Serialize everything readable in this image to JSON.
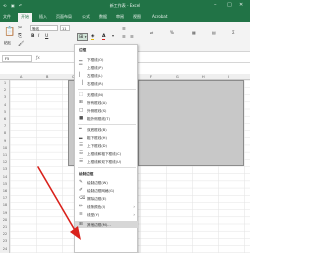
{
  "window": {
    "title": "新工作表 - Excel",
    "minimize": "–",
    "maximize": "□",
    "close": "✕"
  },
  "tabs": [
    "文件",
    "开始",
    "插入",
    "页面布局",
    "公式",
    "数据",
    "审阅",
    "视图",
    "Acrobat"
  ],
  "active_tab": "开始",
  "ribbon": {
    "font_name": "等线",
    "font_size": "11",
    "bold": "B",
    "italic": "I",
    "underline": "U",
    "font_color_letter": "A",
    "paste": "粘贴"
  },
  "name_box": "F5",
  "column_letters": [
    "A",
    "B",
    "C",
    "D",
    "E",
    "F",
    "G",
    "H",
    "I"
  ],
  "row_numbers": [
    "1",
    "2",
    "3",
    "4",
    "5",
    "6",
    "7",
    "8",
    "9",
    "10",
    "11",
    "12",
    "13",
    "14",
    "15",
    "16",
    "17",
    "18",
    "19",
    "20",
    "21",
    "22",
    "23",
    "24"
  ],
  "menu": {
    "section1_title": "边框",
    "border_items": [
      {
        "label": "下框线(O)",
        "icon": "border-bottom-icon"
      },
      {
        "label": "上框线(P)",
        "icon": "border-top-icon"
      },
      {
        "label": "左框线(L)",
        "icon": "border-left-icon"
      },
      {
        "label": "右框线(R)",
        "icon": "border-right-icon"
      },
      {
        "label": "无框线(N)",
        "icon": "border-none-icon"
      },
      {
        "label": "所有框线(A)",
        "icon": "border-all-icon"
      },
      {
        "label": "外侧框线(S)",
        "icon": "border-outside-icon"
      },
      {
        "label": "粗外侧框线(T)",
        "icon": "border-thick-outside-icon"
      },
      {
        "label": "双底框线(B)",
        "icon": "border-double-bottom-icon"
      },
      {
        "label": "粗下框线(H)",
        "icon": "border-thick-bottom-icon"
      },
      {
        "label": "上下框线(D)",
        "icon": "border-top-bottom-icon"
      },
      {
        "label": "上框线和粗下框线(C)",
        "icon": "border-top-thick-bottom-icon"
      },
      {
        "label": "上框线和双下框线(U)",
        "icon": "border-top-double-bottom-icon"
      }
    ],
    "section2_title": "绘制边框",
    "draw_items": [
      {
        "label": "绘制边框(W)",
        "icon": "pencil-icon",
        "arrow": ""
      },
      {
        "label": "绘制边框网格(G)",
        "icon": "grid-pencil-icon",
        "arrow": ""
      },
      {
        "label": "擦除边框(E)",
        "icon": "eraser-icon",
        "arrow": ""
      },
      {
        "label": "线条颜色(I)",
        "icon": "line-color-icon",
        "arrow": "›"
      },
      {
        "label": "线型(Y)",
        "icon": "line-style-icon",
        "arrow": "›"
      },
      {
        "label": "其他边框(M)...",
        "icon": "more-borders-icon",
        "arrow": ""
      }
    ],
    "highlighted_item": "其他边框(M)..."
  },
  "colors": {
    "excel_green": "#217346",
    "selection_gray": "#c8c8c8",
    "arrow_red": "#d9221c"
  }
}
